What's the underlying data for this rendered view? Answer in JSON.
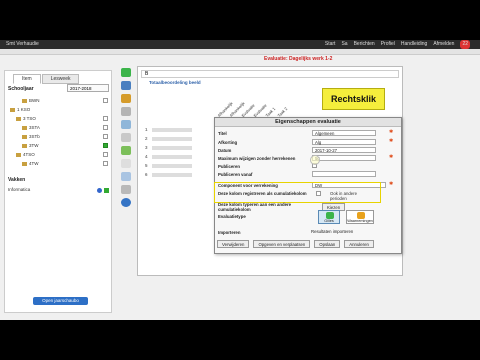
{
  "topbar": {
    "app_name": "Smt Verhaudie",
    "menu": [
      "Start",
      "Sa",
      "Berichten",
      "Profiel",
      "Handleiding",
      "Afmelden"
    ],
    "notification_count": "22"
  },
  "left_panel": {
    "tabs": [
      "Item",
      "Lesweek"
    ],
    "schooljaar_label": "Schooljaar",
    "schooljaar_value": "2017-2018",
    "tree": [
      {
        "label": "BWN",
        "checked": false
      },
      {
        "label": "1 KSO",
        "checked": false
      },
      {
        "label": "3 TSO",
        "checked": false
      },
      {
        "label": "3STA",
        "checked": false
      },
      {
        "label": "3STb",
        "checked": false
      },
      {
        "label": "3TW",
        "checked": true
      },
      {
        "label": "4TSO",
        "checked": false
      },
      {
        "label": "4TW",
        "checked": false
      }
    ],
    "vakken_label": "Vakken",
    "vak_item": "Informatica",
    "open_button": "Open jaarschaubo"
  },
  "main": {
    "search_value": "B",
    "eval_title": "Evaluatie: Dagelijks werk 1-2",
    "total_link": "Totaalbeoordeling beeld",
    "column_heads": [
      "Afhankelijk",
      "Afhankelijk",
      "Evaluatie",
      "Evaluatie",
      "Taak 1",
      "Taak 2"
    ],
    "row_numbers": [
      "1",
      "2",
      "3",
      "4",
      "5",
      "6"
    ]
  },
  "callout": {
    "text": "Rechtsklik"
  },
  "dialog": {
    "title": "Eigenschappen evaluatie",
    "titel_label": "Titel",
    "titel_value": "Algemeen",
    "afkorting_label": "Afkorting",
    "afkorting_value": "Alg",
    "datum_label": "Datum",
    "datum_value": "2017-10-27",
    "max_label": "Maximum wijzigen zonder herrekenen",
    "max_value": "50",
    "publiceren_label": "Publiceren",
    "publiceren_vanaf_label": "Publiceren vanaf",
    "component_label": "Component voor verrekening",
    "component_value": "DW",
    "cumul_label": "Deze kolom registreren als cumulatiekolom",
    "cumul_note": "Ook in andere perioden",
    "typeren_label": "Deze kolom typeren aan een andere cumulatiekolom",
    "kiezen_button": "Kiezen",
    "evaltype_label": "Evaluatietype",
    "type_buttons": [
      "Gilles",
      "Waarnemingen"
    ],
    "importeren_label": "Importeren",
    "resultaten_label": "Resultaten importeren",
    "buttons": [
      "Verwijderen",
      "Opgeven en verplaatsen",
      "Opslaan",
      "Annuleren"
    ]
  },
  "colors": {
    "accent": "#2d6fc6",
    "callout": "#f5ee3c",
    "required_star": "#e05020"
  }
}
